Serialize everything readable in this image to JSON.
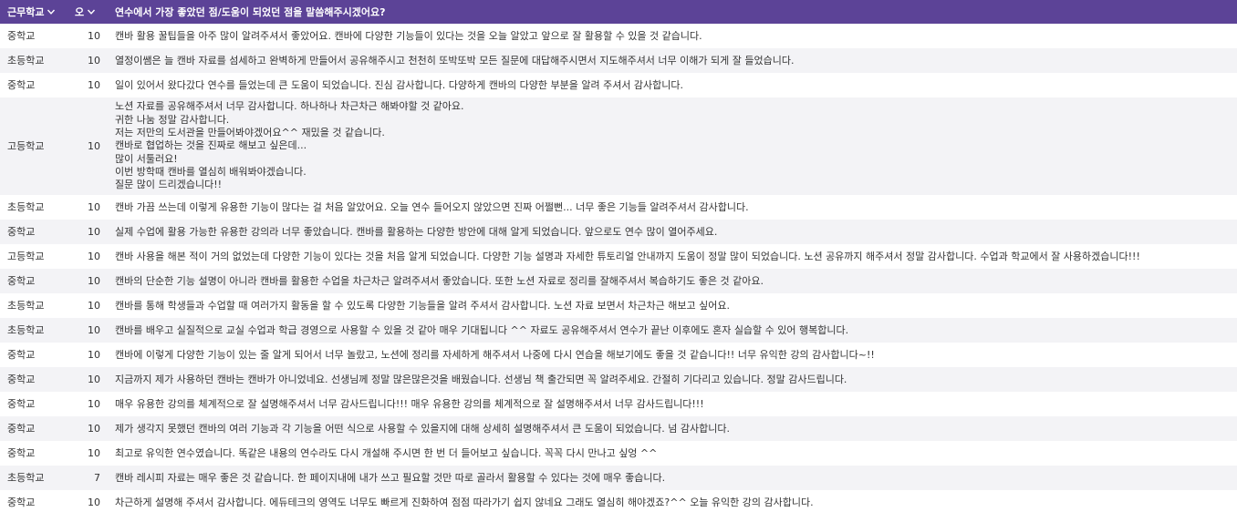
{
  "header": {
    "school_label": "근무학교",
    "score_label": "오",
    "comment_label": "연수에서 가장 좋았던 점/도움이 되었던 점을 말씀해주시겠어요?"
  },
  "rows": [
    {
      "school": "중학교",
      "score": "10",
      "comment": "캔바 활용 꿀팁들을 아주 많이 알려주셔서 좋았어요. 캔바에 다양한 기능들이 있다는 것을 오늘 알았고 앞으로 잘 활용할 수 있을 것 같습니다."
    },
    {
      "school": "초등학교",
      "score": "10",
      "comment": "열정이쌤은 늘 캔바 자료를 섬세하고 완벽하게 만들어서 공유해주시고 천천히 또박또박 모든 질문에 대답해주시면서 지도해주셔서 너무 이해가 되게 잘 들었습니다."
    },
    {
      "school": "중학교",
      "score": "10",
      "comment": "일이 있어서 왔다갔다 연수를 들었는데 큰 도움이 되었습니다. 진심 감사합니다. 다양하게 캔바의 다양한 부분을 알려 주셔서 감사합니다."
    },
    {
      "school": "고등학교",
      "score": "10",
      "comment": "노션 자료를 공유해주셔서 너무 감사합니다. 하나하나 차근차근 해봐야할 것 같아요.\n귀한 나눔 정말 감사합니다.\n저는 저만의 도서관을 만들어봐야겠어요^^ 재밌을 것 같습니다.\n캔바로 협업하는 것을 진짜로 해보고 싶은데...\n많이 서툴러요!\n이번 방학때 캔바를 열심히 배워봐야겠습니다.\n질문 많이 드리겠습니다!!"
    },
    {
      "school": "초등학교",
      "score": "10",
      "comment": "캔바 가끔 쓰는데 이렇게 유용한 기능이 많다는 걸 처음 알았어요. 오늘 연수 들어오지 않았으면 진짜 어쩔뻔... 너무 좋은 기능들 알려주셔서 감사합니다."
    },
    {
      "school": "중학교",
      "score": "10",
      "comment": "실제 수업에 활용 가능한 유용한 강의라 너무 좋았습니다. 캔바를 활용하는 다양한 방안에 대해 알게 되었습니다. 앞으로도 연수 많이 열어주세요."
    },
    {
      "school": "고등학교",
      "score": "10",
      "comment": "캔바 사용을 해본 적이 거의 없었는데 다양한 기능이 있다는 것을 처음 알게 되었습니다. 다양한 기능 설명과 자세한 튜토리얼 안내까지 도움이 정말 많이 되었습니다. 노션 공유까지 해주셔서 정말 감사합니다. 수업과 학교에서 잘 사용하겠습니다!!!"
    },
    {
      "school": "중학교",
      "score": "10",
      "comment": "캔바의 단순한 기능 설명이 아니라 캔바를 활용한 수업을 차근차근 알려주셔서 좋았습니다. 또한 노션 자료로 정리를 잘해주셔서 복습하기도 좋은 것 같아요."
    },
    {
      "school": "초등학교",
      "score": "10",
      "comment": "캔바를 통해 학생들과 수업할 때 여러가지 활동을 할 수 있도록 다양한 기능들을 알려 주셔서 감사합니다. 노션 자료 보면서 차근차근 해보고 싶어요."
    },
    {
      "school": "초등학교",
      "score": "10",
      "comment": "캔바를 배우고 실질적으로 교실 수업과 학급 경영으로 사용할 수 있을 것 같아 매우 기대됩니다 ^^ 자료도 공유해주셔서 연수가 끝난 이후에도 혼자 실습할 수 있어 행복합니다."
    },
    {
      "school": "중학교",
      "score": "10",
      "comment": "캔바에 이렇게 다양한 기능이 있는 줄 알게 되어서 너무 놀랐고, 노션에 정리를 자세하게 해주셔서 나중에 다시 연습을 해보기에도 좋을 것 같습니다!! 너무 유익한 강의 감사합니다~!!"
    },
    {
      "school": "중학교",
      "score": "10",
      "comment": "지금까지 제가 사용하던 캔바는 캔바가 아니었네요. 선생님께 정말 많은많은것을 배웠습니다. 선생님 책 출간되면 꼭 알려주세요. 간절히 기다리고 있습니다. 정말 감사드립니다."
    },
    {
      "school": "중학교",
      "score": "10",
      "comment": "매우 유용한 강의를 체계적으로 잘 설명해주셔서 너무 감사드립니다!!! 매우 유용한 강의를 체계적으로 잘 설명해주셔서 너무 감사드립니다!!!"
    },
    {
      "school": "중학교",
      "score": "10",
      "comment": "제가 생각지 못했던 캔바의 여러 기능과 각 기능을 어떤 식으로 사용할 수 있을지에 대해 상세히 설명해주셔서 큰 도움이 되었습니다. 넘 감사합니다."
    },
    {
      "school": "중학교",
      "score": "10",
      "comment": "최고로 유익한 연수였습니다. 똑같은 내용의 연수라도 다시 개설해 주시면 한 번 더 들어보고 싶습니다. 꼭꼭 다시 만나고 싶엉 ^^"
    },
    {
      "school": "초등학교",
      "score": "7",
      "comment": "캔바 레시피 자료는 매우 좋은 것 같습니다. 한 페이지내에 내가 쓰고 필요할 것만 따로 골라서 활용할 수 있다는 것에 매우 좋습니다."
    },
    {
      "school": "중학교",
      "score": "10",
      "comment": "차근하게 설명해 주셔서 감사합니다. 에듀테크의 영역도 너무도 빠르게 진화하여 점점 따라가기 쉽지 않네요 그래도 열심히 해야겠죠?^^ 오늘 유익한 강의 감사합니다."
    }
  ]
}
